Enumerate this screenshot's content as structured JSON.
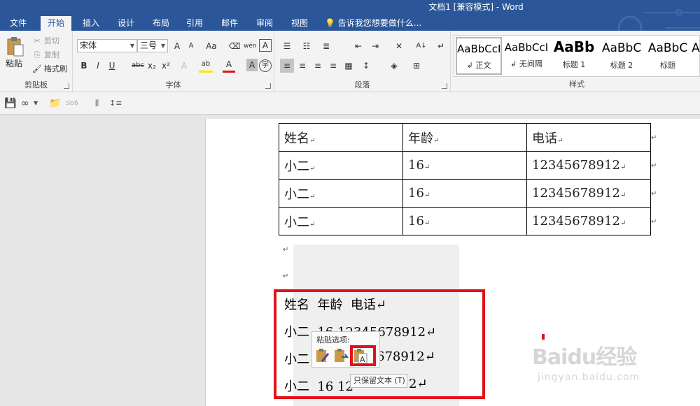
{
  "window": {
    "title": "文档1 [兼容模式] - Word"
  },
  "tabs": [
    {
      "label": "文件"
    },
    {
      "label": "开始"
    },
    {
      "label": "插入"
    },
    {
      "label": "设计"
    },
    {
      "label": "布局"
    },
    {
      "label": "引用"
    },
    {
      "label": "邮件"
    },
    {
      "label": "审阅"
    },
    {
      "label": "视图"
    }
  ],
  "tell_me": "告诉我您想要做什么...",
  "clipboard": {
    "paste": "粘贴",
    "cut": "剪切",
    "copy": "复制",
    "format_painter": "格式刷",
    "label": "剪贴板"
  },
  "font": {
    "name": "宋体",
    "size": "三号",
    "grow": "A",
    "shrink": "A",
    "case": "Aa",
    "phonetic": "wén",
    "border_char": "A",
    "bold": "B",
    "italic": "I",
    "underline": "U",
    "strike": "abc",
    "sub": "x₂",
    "sup": "x²",
    "effects": "A",
    "highlight": "ab",
    "color": "A",
    "shade": "A",
    "circle": "字",
    "label": "字体"
  },
  "paragraph": {
    "label": "段落"
  },
  "styles": {
    "items": [
      {
        "sample": "AaBbCcI",
        "name": "↲ 正文"
      },
      {
        "sample": "AaBbCcI",
        "name": "↲ 无间隔"
      },
      {
        "sample": "AaBb",
        "name": "标题 1"
      },
      {
        "sample": "AaBbC",
        "name": "标题 2"
      },
      {
        "sample": "AaBbC",
        "name": "标题"
      },
      {
        "sample": "A",
        "name": ""
      }
    ],
    "label": "样式"
  },
  "qat": {
    "size": "sis6"
  },
  "table": {
    "headers": [
      "姓名",
      "年龄",
      "电话"
    ],
    "rows": [
      [
        "小二",
        "16",
        "12345678912"
      ],
      [
        "小二",
        "16",
        "12345678912"
      ],
      [
        "小二",
        "16",
        "12345678912"
      ]
    ],
    "cell_mark": "↵"
  },
  "pasted_text": {
    "lines": [
      "姓名  年龄  电话↵",
      "小二  16 12345678912↵",
      "小二  16 12345678912↵",
      "小二  16 12345678912↵"
    ],
    "visible": [
      "姓名  年龄  电话↵",
      "小二  16 12345678912↵",
      "小二",
      "678912↵",
      "小二  16 12",
      "2↵"
    ]
  },
  "paste_options": {
    "title": "粘贴选项:",
    "tooltip": "只保留文本 (T)"
  },
  "watermark": {
    "logo": "Baidu经验",
    "url": "jingyan.baidu.com"
  },
  "colors": {
    "accent": "#2b579a",
    "highlight_red": "#e2121b"
  }
}
